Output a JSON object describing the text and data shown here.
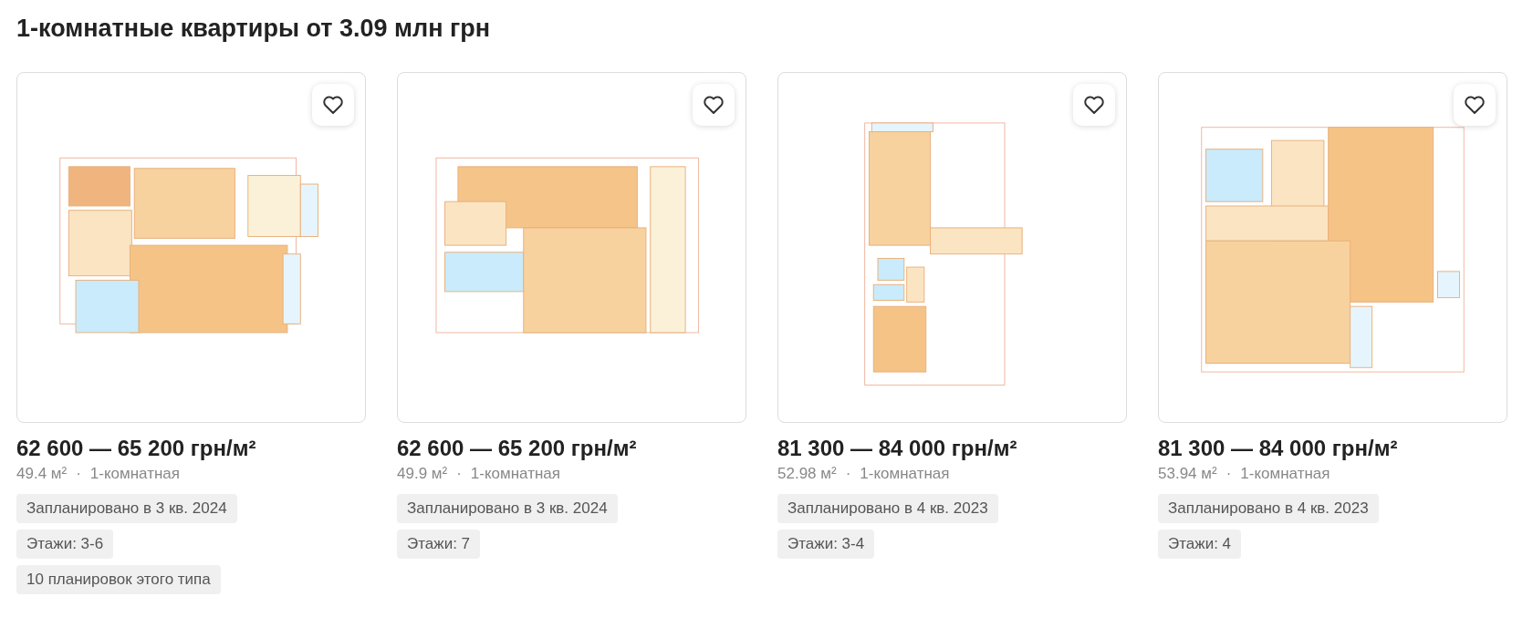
{
  "heading": "1-комнатные квартиры от 3.09 млн грн",
  "cards": [
    {
      "plan": {
        "kind": "picture"
      },
      "price": "62 600 — 65 200 грн/м²",
      "area": "49.4 м²",
      "separator": "·",
      "rooms": "1-комнатная",
      "tags": [
        "Запланировано в 3 кв. 2024",
        "Этажи: 3-6",
        "10 планировок этого типа"
      ]
    },
    {
      "plan": {
        "kind": "picture"
      },
      "price": "62 600 — 65 200 грн/м²",
      "area": "49.9 м²",
      "separator": "·",
      "rooms": "1-комнатная",
      "tags": [
        "Запланировано в 3 кв. 2024",
        "Этажи: 7"
      ]
    },
    {
      "plan": {
        "kind": "picture"
      },
      "price": "81 300 — 84 000 грн/м²",
      "area": "52.98 м²",
      "separator": "·",
      "rooms": "1-комнатная",
      "tags": [
        "Запланировано в 4 кв. 2023",
        "Этажи: 3-4"
      ]
    },
    {
      "plan": {
        "kind": "picture"
      },
      "price": "81 300 — 84 000 грн/м²",
      "area": "53.94 м²",
      "separator": "·",
      "rooms": "1-комнатная",
      "tags": [
        "Запланировано в 4 кв. 2023",
        "Этажи: 4"
      ]
    }
  ]
}
